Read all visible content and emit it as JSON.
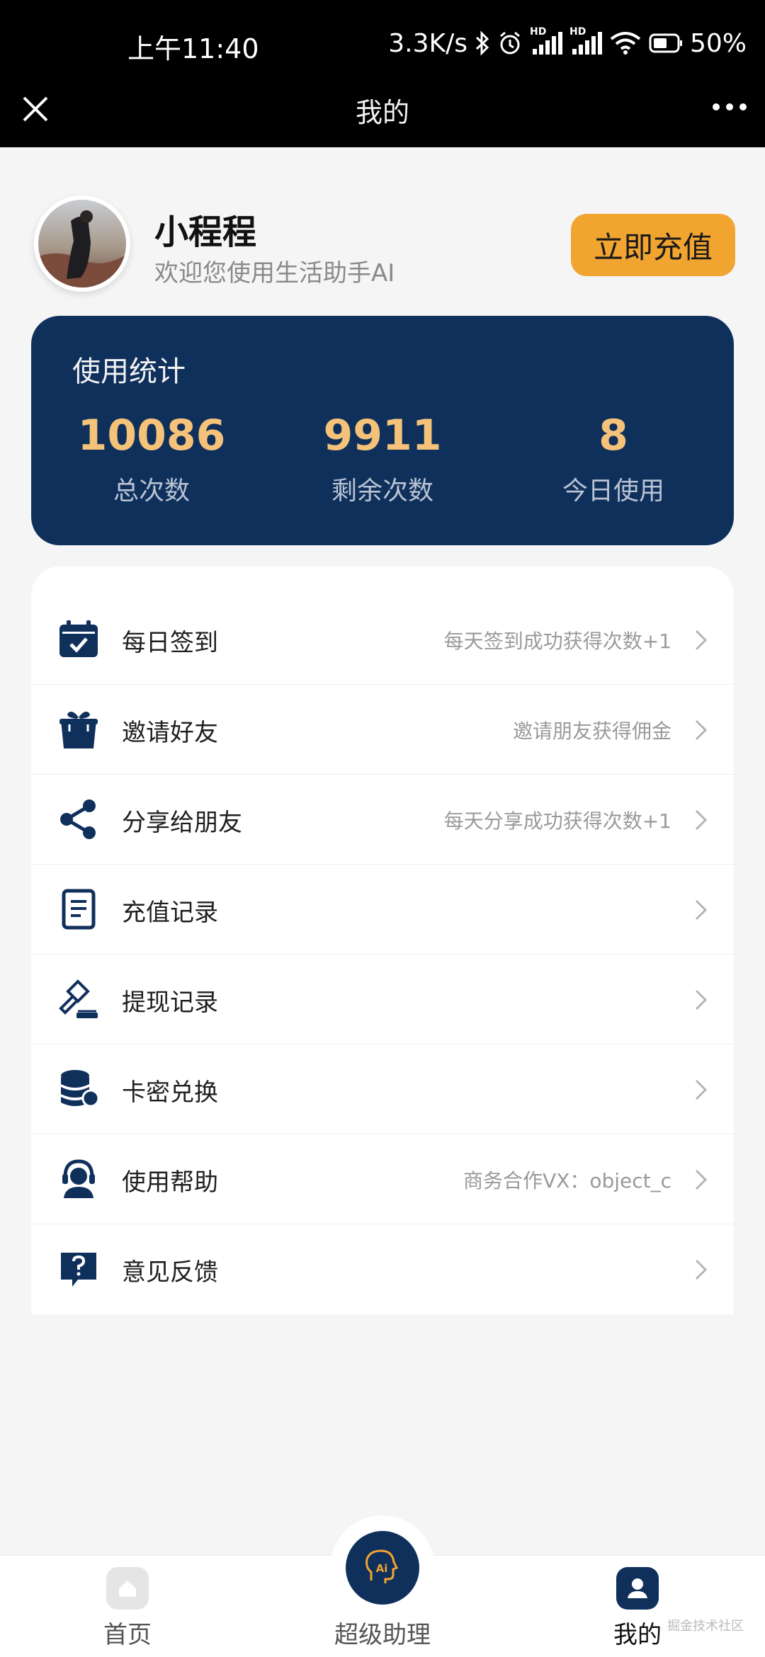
{
  "status_bar": {
    "time": "上午11:40",
    "network_speed": "3.3K/s",
    "signal_label_1": "HD",
    "signal_label_2": "HD",
    "battery": "50%"
  },
  "nav": {
    "title": "我的",
    "close_icon": "close-icon",
    "more_icon": "more-icon"
  },
  "profile": {
    "name": "小程程",
    "welcome": "欢迎您使用生活助手AI",
    "recharge_label": "立即充值"
  },
  "stats": {
    "title": "使用统计",
    "items": [
      {
        "value": "10086",
        "label": "总次数"
      },
      {
        "value": "9911",
        "label": "剩余次数"
      },
      {
        "value": "8",
        "label": "今日使用"
      }
    ]
  },
  "menu": {
    "items": [
      {
        "label": "每日签到",
        "desc": "每天签到成功获得次数+1",
        "icon": "calendar-check-icon"
      },
      {
        "label": "邀请好友",
        "desc": "邀请朋友获得佣金",
        "icon": "gift-icon"
      },
      {
        "label": "分享给朋友",
        "desc": "每天分享成功获得次数+1",
        "icon": "share-icon"
      },
      {
        "label": "充值记录",
        "desc": "",
        "icon": "document-icon"
      },
      {
        "label": "提现记录",
        "desc": "",
        "icon": "gavel-icon"
      },
      {
        "label": "卡密兑换",
        "desc": "",
        "icon": "coins-icon"
      },
      {
        "label": "使用帮助",
        "desc": "商务合作VX：object_c",
        "icon": "support-agent-icon"
      },
      {
        "label": "意见反馈",
        "desc": "",
        "icon": "question-bubble-icon"
      }
    ]
  },
  "tabbar": {
    "home": "首页",
    "assistant": "超级助理",
    "assistant_badge": "Ai",
    "mine": "我的"
  },
  "watermark": "掘金技术社区",
  "colors": {
    "navy": "#10305c",
    "accent_orange": "#f2a431",
    "stat_value": "#f5c27a",
    "background": "#f5f5f5"
  }
}
